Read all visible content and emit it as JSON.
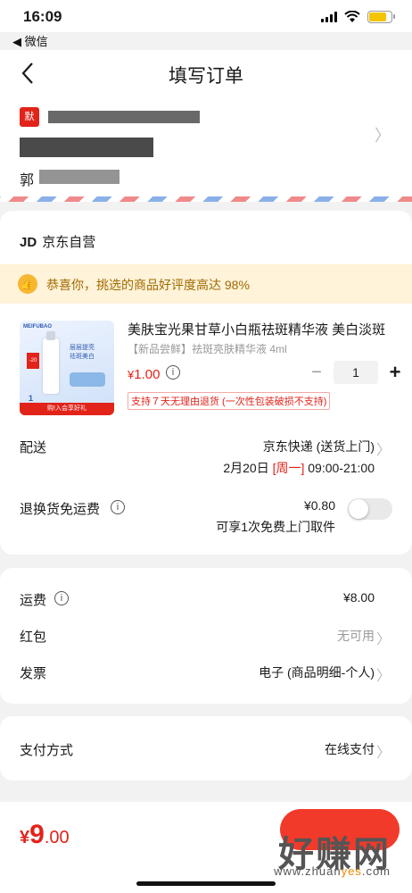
{
  "status_bar": {
    "time": "16:09",
    "back_app": "◀ 微信",
    "battery_level": 0.8
  },
  "nav": {
    "title": "填写订单"
  },
  "address": {
    "tag": "默",
    "name": "郭"
  },
  "shop": {
    "logo": "JD",
    "name": "京东自营",
    "praise": "恭喜你，挑选的商品好评度高达 98%",
    "product": {
      "title": "美肤宝光果甘草小白瓶祛斑精华液 美白淡斑",
      "subtitle": "【新品尝鲜】祛斑亮肤精华液 4ml",
      "price_currency": "¥",
      "price": "1.00",
      "quantity": "1",
      "return_policy": "支持７天无理由退货 (一次性包装破损不支持)",
      "image": {
        "brand": "MEIFUBAO",
        "slogan_1": "层层提亮",
        "slogan_2": "祛斑美白",
        "promo": "-20",
        "strip": "购!入会享好礼",
        "badge": "1"
      }
    },
    "delivery": {
      "label": "配送",
      "method": "京东快递 (送货上门)",
      "date": "2月20日",
      "weekday": "[周一]",
      "time_range": "09:00-21:00"
    },
    "return_fee": {
      "label": "退换货免运费",
      "price": "¥0.80",
      "note": "可享1次免费上门取件",
      "enabled": false
    }
  },
  "fees": {
    "shipping_label": "运费",
    "shipping_value": "¥8.00",
    "redpacket_label": "红包",
    "redpacket_value": "无可用",
    "invoice_label": "发票",
    "invoice_value": "电子 (商品明细-个人)"
  },
  "payment": {
    "label": "支付方式",
    "value": "在线支付"
  },
  "bottom": {
    "currency": "¥",
    "total_int": "9",
    "total_dec": ".00",
    "watermark": "好赚网",
    "watermark_url_1": "www.zhuan",
    "watermark_url_2": "yes",
    "watermark_url_3": ".com"
  },
  "colors": {
    "accent": "#e2231a",
    "praise_bg": "#fff3d9",
    "button": "#f23a2a"
  }
}
